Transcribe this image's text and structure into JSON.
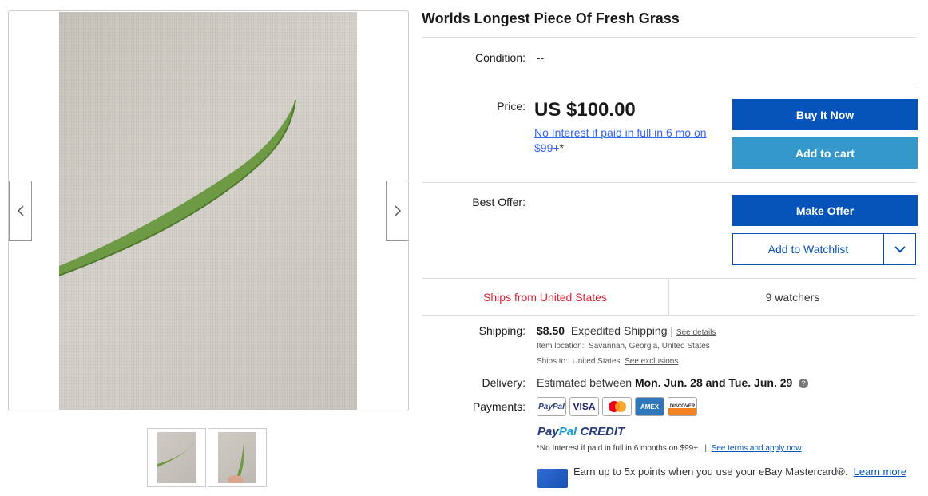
{
  "listing": {
    "title": "Worlds Longest Piece Of Fresh Grass",
    "condition_label": "Condition:",
    "condition_value": "--",
    "price_label": "Price:",
    "price": "US $100.00",
    "financing_link": "No Interest if paid in full in 6 mo on $99+",
    "financing_suffix": "*",
    "best_offer_label": "Best Offer:"
  },
  "buttons": {
    "buy_it_now": "Buy It Now",
    "add_to_cart": "Add to cart",
    "make_offer": "Make Offer",
    "add_to_watchlist": "Add to Watchlist"
  },
  "ships_row": {
    "ships_from": "Ships from United States",
    "watchers": "9 watchers"
  },
  "shipping": {
    "label": "Shipping:",
    "cost": "$8.50",
    "method": "Expedited Shipping",
    "separator": "|",
    "see_details": "See details",
    "item_location_label": "Item location:",
    "item_location": "Savannah, Georgia, United States",
    "ships_to_label": "Ships to:",
    "ships_to": "United States",
    "see_exclusions": "See exclusions"
  },
  "delivery": {
    "label": "Delivery:",
    "prefix": "Estimated between",
    "range": "Mon. Jun. 28 and Tue. Jun. 29",
    "help_glyph": "?"
  },
  "payments": {
    "label": "Payments:",
    "methods": [
      "PayPal",
      "VISA",
      "Mastercard",
      "AMEX",
      "DISCOVER"
    ],
    "paypal_credit_a": "Pay",
    "paypal_credit_b": "Pal",
    "paypal_credit_c": " CREDIT",
    "credit_note": "*No Interest if paid in full in 6 months on $99+.",
    "credit_sep": "|",
    "credit_terms": "See terms and apply now",
    "mastercard_promo": "Earn up to 5x points when you use your eBay Mastercard®.",
    "learn_more": "Learn more"
  },
  "colors": {
    "primary_blue": "#0654ba",
    "cart_blue": "#3498ca",
    "link_blue": "#3665f3",
    "ships_red": "#dd1e31"
  }
}
